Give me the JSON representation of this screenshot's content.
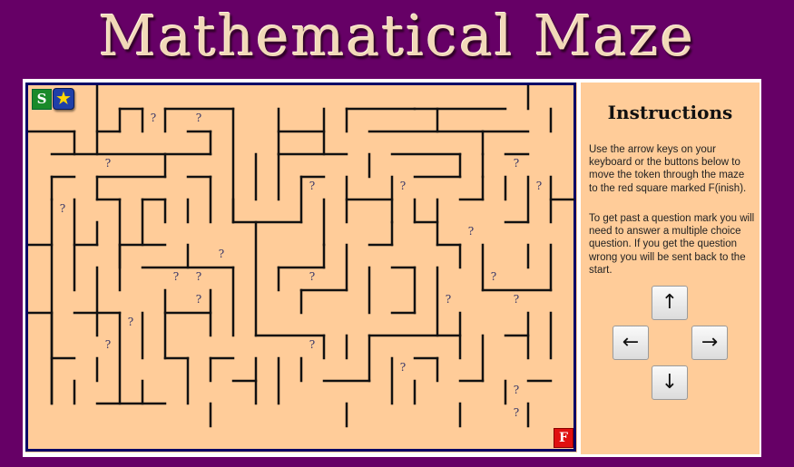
{
  "title": "Mathematical Maze",
  "maze": {
    "start_label": "S",
    "token_glyph": "★",
    "finish_label": "F",
    "question_glyph": "?",
    "question_marks": [
      [
        5,
        0
      ],
      [
        7,
        0
      ],
      [
        3,
        2
      ],
      [
        12,
        3
      ],
      [
        16,
        3
      ],
      [
        21,
        2
      ],
      [
        22,
        3
      ],
      [
        1,
        4
      ],
      [
        19,
        5
      ],
      [
        8,
        6
      ],
      [
        6,
        7
      ],
      [
        7,
        7
      ],
      [
        12,
        7
      ],
      [
        20,
        7
      ],
      [
        7,
        8
      ],
      [
        18,
        8
      ],
      [
        21,
        8
      ],
      [
        4,
        9
      ],
      [
        3,
        10
      ],
      [
        12,
        10
      ],
      [
        16,
        11
      ],
      [
        21,
        12
      ],
      [
        21,
        13
      ]
    ]
  },
  "instructions": {
    "title": "Instructions",
    "paragraph1": "Use the arrow keys on your keyboard or the buttons below to move the token through the maze to the red square marked F(inish).",
    "paragraph2": "To get past a question mark you will need to answer a multiple choice question. If you get the question wrong you will be sent back to the start."
  },
  "controls": {
    "up": "↑",
    "left": "←",
    "right": "→",
    "down": "↓"
  },
  "colors": {
    "background": "#660066",
    "maze_floor": "#ffcc99",
    "maze_border": "#000066",
    "title": "#f2d9b8",
    "start": "#1a8a2a",
    "finish": "#e01010"
  }
}
